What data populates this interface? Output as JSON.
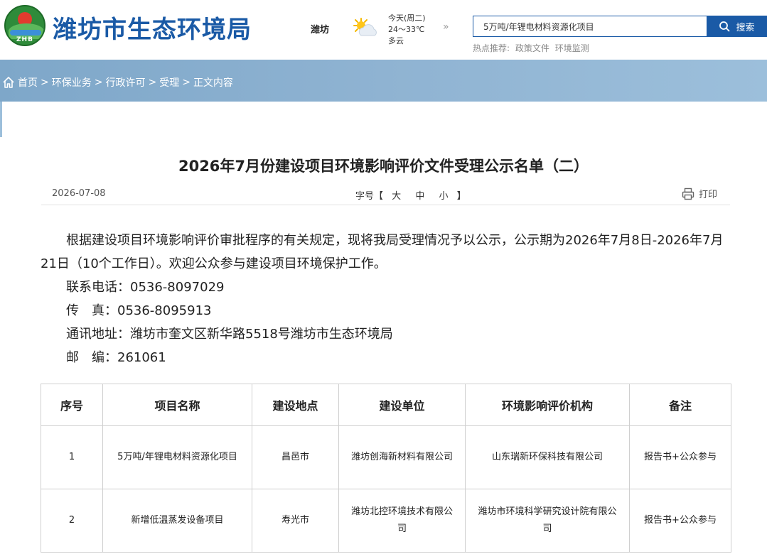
{
  "header": {
    "logo_text": "ZHB",
    "site_title": "潍坊市生态环境局",
    "city": "潍坊",
    "weather": {
      "day": "今天(周二)",
      "temp": "24～33℃",
      "condition": "多云",
      "icon": "partly-cloudy-icon"
    },
    "arrow": "»",
    "search": {
      "value": "5万吨/年锂电材料资源化项目",
      "button_label": "搜索"
    },
    "hot": {
      "label": "热点推荐:",
      "links": [
        "政策文件",
        "环境监测"
      ]
    }
  },
  "breadcrumb": {
    "items": [
      "首页",
      "环保业务",
      "行政许可",
      "受理",
      "正文内容"
    ],
    "separator": ">"
  },
  "article": {
    "title": "2026年7月份建设项目环境影响评价文件受理公示名单（二）",
    "date": "2026-07-08",
    "font_size": {
      "label": "字号【",
      "options": [
        "大",
        "中",
        "小"
      ],
      "close": "】"
    },
    "print_label": "打印",
    "intro": "根据建设项目环境影响评价审批程序的有关规定，现将我局受理情况予以公示，公示期为2026年7月8日-2026年7月21日（10个工作日）。欢迎公众参与建设项目环境保护工作。",
    "contacts": [
      "联系电话：0536-8097029",
      "传　真：0536-8095913",
      "通讯地址：潍坊市奎文区新华路5518号潍坊市生态环境局",
      "邮　编：261061"
    ]
  },
  "table": {
    "headers": [
      "序号",
      "项目名称",
      "建设地点",
      "建设单位",
      "环境影响评价机构",
      "备注"
    ],
    "rows": [
      [
        "1",
        "5万吨/年锂电材料资源化项目",
        "昌邑市",
        "潍坊创海新材料有限公司",
        "山东瑞新环保科技有限公司",
        "报告书+公众参与"
      ],
      [
        "2",
        "新增低温蒸发设备项目",
        "寿光市",
        "潍坊北控环境技术有限公司",
        "潍坊市环境科学研究设计院有限公司",
        "报告书+公众参与"
      ]
    ]
  },
  "colors": {
    "brand": "#1a5aa6",
    "banner": "#8fb3d2"
  }
}
